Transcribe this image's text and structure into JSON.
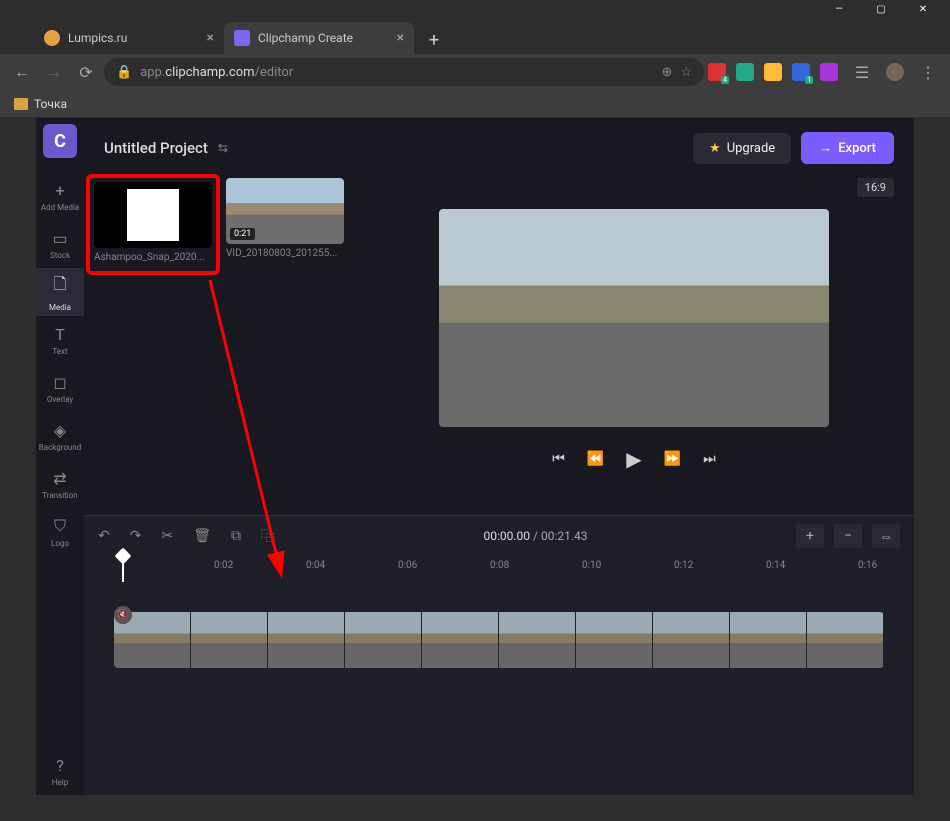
{
  "browser": {
    "tabs": [
      {
        "title": "Lumpics.ru",
        "active": false
      },
      {
        "title": "Clipchamp Create",
        "active": true
      }
    ],
    "url_prefix": "app.",
    "url_domain": "clipchamp.com",
    "url_path": "/editor",
    "bookmark": "Точка"
  },
  "win_controls": {
    "min": "—",
    "max": "▢",
    "close": "✕"
  },
  "app": {
    "logo": "C",
    "project_title": "Untitled Project",
    "upgrade_label": "Upgrade",
    "export_label": "Export",
    "aspect_ratio": "16:9",
    "sidebar": [
      {
        "icon": "+",
        "label": "Add Media"
      },
      {
        "icon": "▭",
        "label": "Stock"
      },
      {
        "icon": "🗋",
        "label": "Media"
      },
      {
        "icon": "T",
        "label": "Text"
      },
      {
        "icon": "◻",
        "label": "Overlay"
      },
      {
        "icon": "◈",
        "label": "Background"
      },
      {
        "icon": "⇄",
        "label": "Transition"
      },
      {
        "icon": "⛉",
        "label": "Logo"
      }
    ],
    "help_label": "Help",
    "media": [
      {
        "name": "Ashampoo_Snap_2020...",
        "duration": "",
        "kind": "qr"
      },
      {
        "name": "VID_20180803_201255...",
        "duration": "0:21",
        "kind": "video"
      }
    ],
    "player": {
      "skip_back": "⏮",
      "rewind": "⏪",
      "play": "▶",
      "forward": "⏩",
      "skip_fwd": "⏭"
    },
    "timeline": {
      "tools": {
        "undo": "↶",
        "redo": "↷",
        "cut": "✂",
        "delete": "🗑",
        "copy": "⧉",
        "dup": "⿻"
      },
      "time_current": "00:00.00",
      "time_total": "00:21.43",
      "zoom_in": "+",
      "zoom_out": "−",
      "zoom_fit": "⇔",
      "ticks": [
        "0:02",
        "0:04",
        "0:06",
        "0:08",
        "0:10",
        "0:12",
        "0:14",
        "0:16"
      ]
    }
  }
}
